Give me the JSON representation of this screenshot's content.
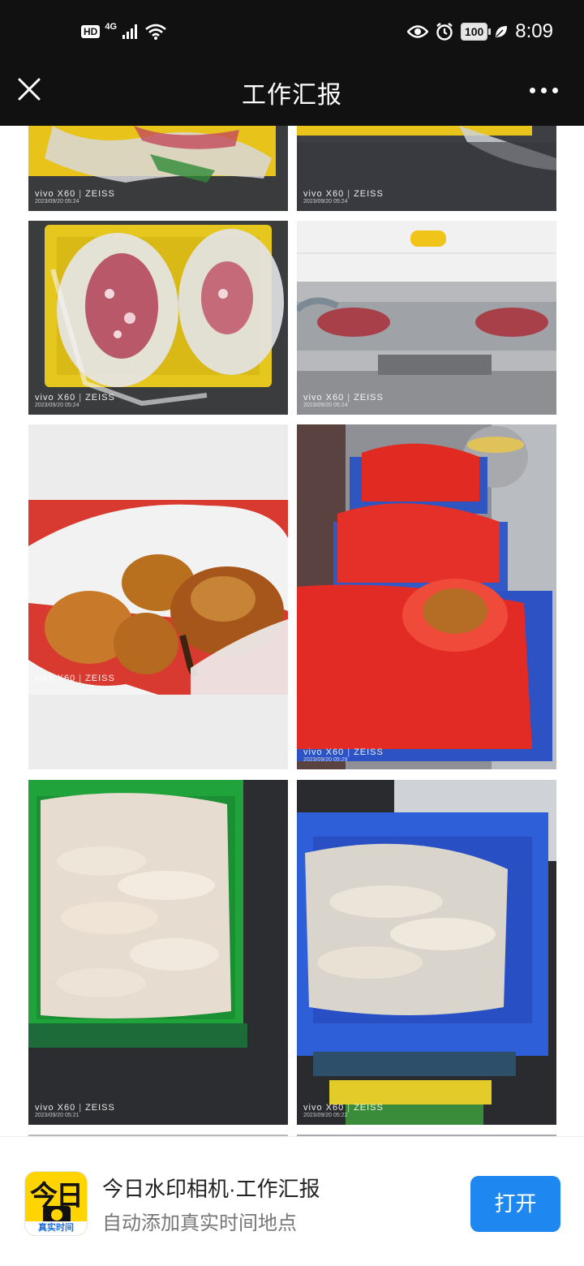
{
  "status_bar": {
    "hd": "HD",
    "network": "4G",
    "battery": "100",
    "time": "8:09"
  },
  "nav": {
    "title": "工作汇报"
  },
  "photos": [
    {
      "brand": "vivo X60",
      "lens": "ZEISS",
      "date": "2023/09/20 05:24"
    },
    {
      "brand": "vivo X60",
      "lens": "ZEISS",
      "date": "2023/09/20 05:24"
    },
    {
      "brand": "vivo X60",
      "lens": "ZEISS",
      "date": "2023/09/20 05:24"
    },
    {
      "brand": "vivo X60",
      "lens": "ZEISS",
      "date": "2023/09/20 05:24"
    },
    {
      "brand": "vivo X60",
      "lens": "ZEISS",
      "date": ""
    },
    {
      "brand": "vivo X60",
      "lens": "ZEISS",
      "date": "2023/09/20 05:29"
    },
    {
      "brand": "vivo X60",
      "lens": "ZEISS",
      "date": "2023/09/20 05:21"
    },
    {
      "brand": "vivo X60",
      "lens": "ZEISS",
      "date": "2023/09/20 05:22"
    }
  ],
  "banner": {
    "icon_big": "今日",
    "icon_small": "真实时间",
    "title": "今日水印相机·工作汇报",
    "subtitle": "自动添加真实时间地点",
    "open_label": "打开"
  }
}
